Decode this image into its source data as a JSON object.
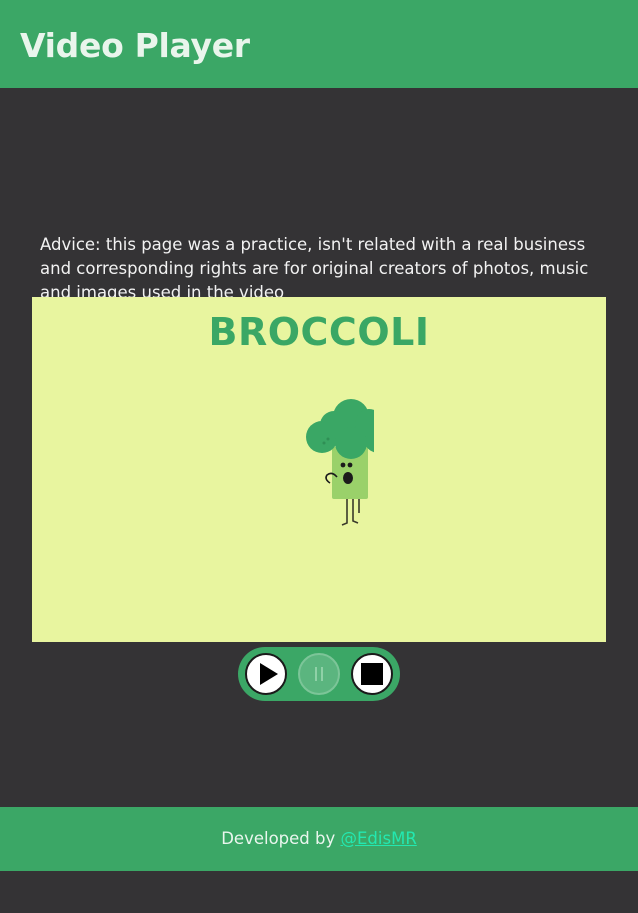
{
  "header": {
    "title": "Video Player"
  },
  "advice": {
    "text": "Advice: this page was a practice, isn't related with a real business and corresponding rights are for original creators of photos, music and images used in the video"
  },
  "video": {
    "title_text": "BROCCOLI",
    "character": "broccoli-character-icon"
  },
  "controls": {
    "play_icon": "play-icon",
    "pause_icon": "pause-icon",
    "stop_icon": "stop-icon",
    "pause_enabled": false
  },
  "footer": {
    "prefix": "Developed by ",
    "link_text": "@EdisMR"
  },
  "colors": {
    "accent": "#3ba766",
    "background": "#343335",
    "video_background": "#e8f59f",
    "link": "#23e8b0"
  }
}
